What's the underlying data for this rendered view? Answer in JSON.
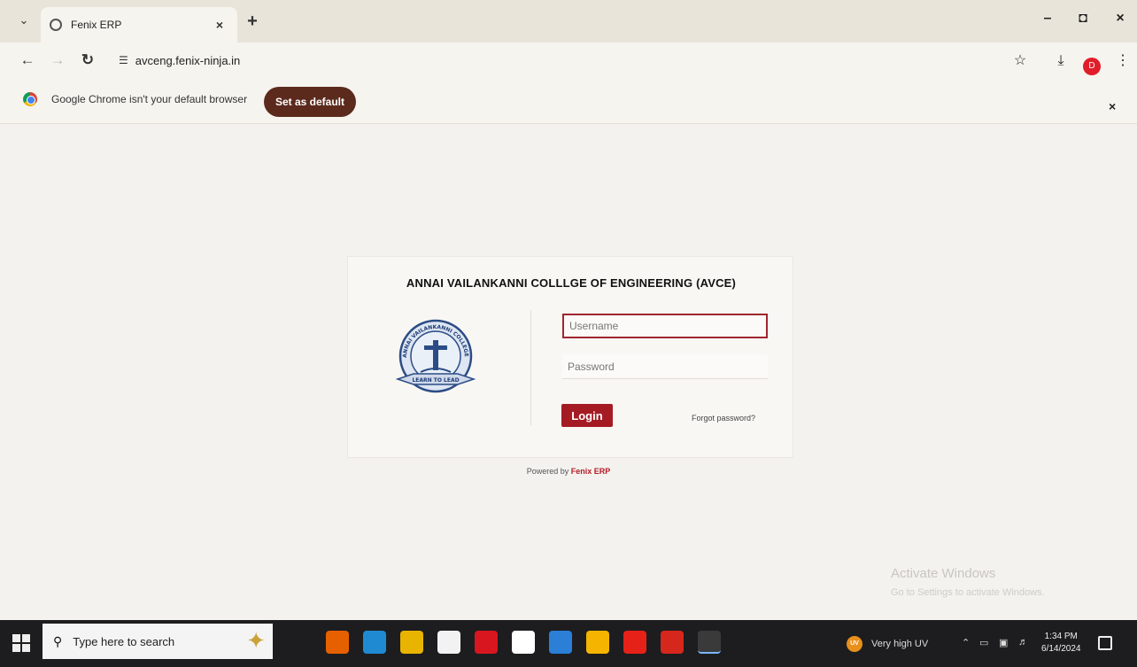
{
  "browser": {
    "tab": {
      "title": "Fenix ERP",
      "close": "×"
    },
    "new_tab": "+",
    "window": {
      "minimize": "–",
      "maximize": "◘",
      "close": "×"
    },
    "url": "avceng.fenix-ninja.in",
    "profile_letter": "D"
  },
  "infobar": {
    "message": "Google Chrome isn't your default browser",
    "button": "Set as default",
    "close": "×"
  },
  "login": {
    "college_name": "ANNAI VAILANKANNI COLLLGE OF ENGINEERING (AVCE)",
    "seal_text_top": "ANNAI VAILANKANNI COLLEGE OF ENGINEERING",
    "seal_text_bottom": "LEARN TO LEAD",
    "username_placeholder": "Username",
    "password_placeholder": "Password",
    "login_button": "Login",
    "forgot": "Forgot password?",
    "powered_prefix": "Powered by ",
    "powered_brand": "Fenix ERP"
  },
  "watermark": {
    "line1": "Activate Windows",
    "line2": "Go to Settings to activate Windows."
  },
  "taskbar": {
    "search_placeholder": "Type here to search",
    "weather": "Very high UV",
    "weather_badge": "UV",
    "time": "1:34 PM",
    "date": "6/14/2024",
    "apps": [
      {
        "name": "task-view",
        "color": "#1d1d1f"
      },
      {
        "name": "firefox",
        "color": "#e66000"
      },
      {
        "name": "edge",
        "color": "#1f8ad2"
      },
      {
        "name": "file-explorer",
        "color": "#e8b400"
      },
      {
        "name": "store",
        "color": "#f2f2f2"
      },
      {
        "name": "opera",
        "color": "#d8161f"
      },
      {
        "name": "notepad",
        "color": "#ffffff"
      },
      {
        "name": "mail",
        "color": "#2b7fd6"
      },
      {
        "name": "chrome",
        "color": "#f4b400"
      },
      {
        "name": "youtube",
        "color": "#e62117"
      },
      {
        "name": "app-red",
        "color": "#d6271d"
      },
      {
        "name": "chrome-active",
        "color": "#3a3a3a"
      }
    ]
  }
}
